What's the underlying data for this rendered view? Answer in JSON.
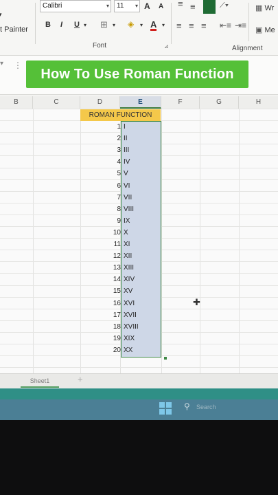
{
  "ribbon": {
    "font_name": "Calibri",
    "font_size": "11",
    "format_painter_label": "t Painter",
    "bold": "B",
    "italic": "I",
    "underline": "U",
    "font_color_letter": "A",
    "increase_font": "A",
    "decrease_font": "A",
    "font_group_label": "Font",
    "alignment_group_label": "Alignment",
    "wrap_label": "Wr",
    "merge_label": "Me"
  },
  "banner": {
    "text": "How To Use Roman Function"
  },
  "columns": [
    "B",
    "C",
    "D",
    "E",
    "F",
    "G",
    "H"
  ],
  "selected_column": "E",
  "table": {
    "header": "ROMAN FUNCTION",
    "rows": [
      {
        "n": "1",
        "r": "I"
      },
      {
        "n": "2",
        "r": "II"
      },
      {
        "n": "3",
        "r": "III"
      },
      {
        "n": "4",
        "r": "IV"
      },
      {
        "n": "5",
        "r": "V"
      },
      {
        "n": "6",
        "r": "VI"
      },
      {
        "n": "7",
        "r": "VII"
      },
      {
        "n": "8",
        "r": "VIII"
      },
      {
        "n": "9",
        "r": "IX"
      },
      {
        "n": "10",
        "r": "X"
      },
      {
        "n": "11",
        "r": "XI"
      },
      {
        "n": "12",
        "r": "XII"
      },
      {
        "n": "13",
        "r": "XIII"
      },
      {
        "n": "14",
        "r": "XIV"
      },
      {
        "n": "15",
        "r": "XV"
      },
      {
        "n": "16",
        "r": "XVI"
      },
      {
        "n": "17",
        "r": "XVII"
      },
      {
        "n": "18",
        "r": "XVIII"
      },
      {
        "n": "19",
        "r": "XIX"
      },
      {
        "n": "20",
        "r": "XX"
      }
    ]
  },
  "sheet_tab": "Sheet1",
  "taskbar": {
    "search_text": "Search"
  },
  "colors": {
    "banner": "#55c038",
    "header_cell": "#f4c84a",
    "selection": "#ced7e7",
    "selection_border": "#3f8a46"
  }
}
